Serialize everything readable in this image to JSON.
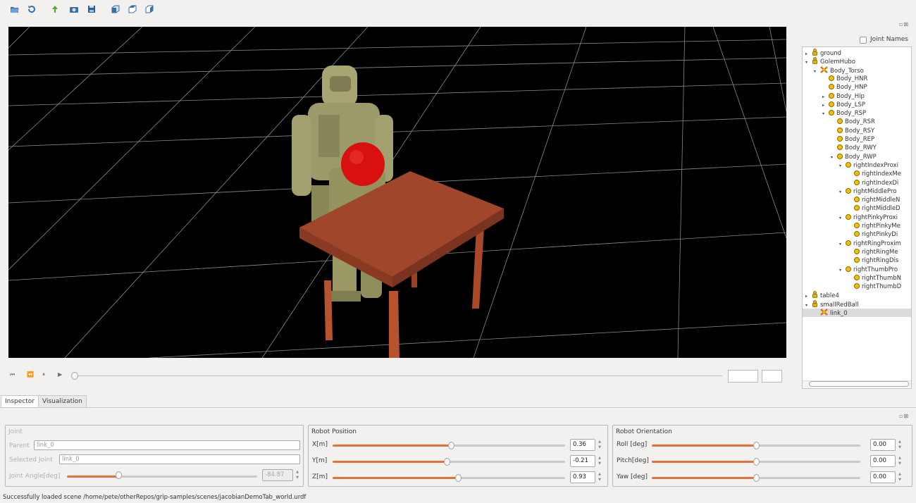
{
  "toolbar": {
    "icons": [
      "open-folder-icon",
      "reload-icon",
      "run-icon",
      "camera-icon",
      "save-icon",
      "front-view-icon",
      "top-view-icon",
      "side-view-icon"
    ]
  },
  "playback": {
    "icons": [
      "skip-start-icon",
      "rewind-icon",
      "pause-icon",
      "play-icon"
    ],
    "frame_value": "",
    "step_value": ""
  },
  "panel": {
    "joint_names_label": "Joint Names",
    "joint_names_checked": false,
    "dock_buttons": "▫⊠"
  },
  "tree": [
    {
      "label": "ground",
      "icon": "robot-icon",
      "arrow": "▸",
      "depth": 0
    },
    {
      "label": "GolemHubo",
      "icon": "robot-icon",
      "arrow": "▾",
      "depth": 0
    },
    {
      "label": "Body_Torso",
      "icon": "root-link-icon",
      "arrow": "▾",
      "depth": 1
    },
    {
      "label": "Body_HNR",
      "icon": "link-icon",
      "arrow": "",
      "depth": 2
    },
    {
      "label": "Body_HNP",
      "icon": "link-icon",
      "arrow": "",
      "depth": 2
    },
    {
      "label": "Body_Hip",
      "icon": "link-icon",
      "arrow": "▸",
      "depth": 2
    },
    {
      "label": "Body_LSP",
      "icon": "link-icon",
      "arrow": "▸",
      "depth": 2
    },
    {
      "label": "Body_RSP",
      "icon": "link-icon",
      "arrow": "▾",
      "depth": 2
    },
    {
      "label": "Body_RSR",
      "icon": "link-icon",
      "arrow": "",
      "depth": 3
    },
    {
      "label": "Body_RSY",
      "icon": "link-icon",
      "arrow": "",
      "depth": 3
    },
    {
      "label": "Body_REP",
      "icon": "link-icon",
      "arrow": "",
      "depth": 3
    },
    {
      "label": "Body_RWY",
      "icon": "link-icon",
      "arrow": "",
      "depth": 3
    },
    {
      "label": "Body_RWP",
      "icon": "link-icon",
      "arrow": "▾",
      "depth": 3
    },
    {
      "label": "rightIndexProxi",
      "icon": "link-icon",
      "arrow": "▾",
      "depth": 4
    },
    {
      "label": "rightIndexMe",
      "icon": "link-icon",
      "arrow": "",
      "depth": 5
    },
    {
      "label": "rightIndexDi",
      "icon": "link-icon",
      "arrow": "",
      "depth": 5
    },
    {
      "label": "rightMiddlePro",
      "icon": "link-icon",
      "arrow": "▾",
      "depth": 4
    },
    {
      "label": "rightMiddleN",
      "icon": "link-icon",
      "arrow": "",
      "depth": 5
    },
    {
      "label": "rightMiddleD",
      "icon": "link-icon",
      "arrow": "",
      "depth": 5
    },
    {
      "label": "rightPinkyProxi",
      "icon": "link-icon",
      "arrow": "▾",
      "depth": 4
    },
    {
      "label": "rightPinkyMe",
      "icon": "link-icon",
      "arrow": "",
      "depth": 5
    },
    {
      "label": "rightPinkyDi",
      "icon": "link-icon",
      "arrow": "",
      "depth": 5
    },
    {
      "label": "rightRingProxim",
      "icon": "link-icon",
      "arrow": "▾",
      "depth": 4
    },
    {
      "label": "rightRingMe",
      "icon": "link-icon",
      "arrow": "",
      "depth": 5
    },
    {
      "label": "rightRingDis",
      "icon": "link-icon",
      "arrow": "",
      "depth": 5
    },
    {
      "label": "rightThumbPro",
      "icon": "link-icon",
      "arrow": "▾",
      "depth": 4
    },
    {
      "label": "rightThumbN",
      "icon": "link-icon",
      "arrow": "",
      "depth": 5
    },
    {
      "label": "rightThumbD",
      "icon": "link-icon",
      "arrow": "",
      "depth": 5
    },
    {
      "label": "table4",
      "icon": "robot-icon",
      "arrow": "▸",
      "depth": 0
    },
    {
      "label": "smallRedBall",
      "icon": "robot-icon",
      "arrow": "▾",
      "depth": 0
    },
    {
      "label": "link_0",
      "icon": "root-link-icon",
      "arrow": "",
      "depth": 1,
      "selected": true
    }
  ],
  "tabs": [
    {
      "label": "Inspector",
      "active": true
    },
    {
      "label": "Visualization",
      "active": false
    }
  ],
  "inspector": {
    "joint": {
      "title": "Joint",
      "parent_label": "Parent",
      "parent_value": "link_0",
      "selected_label": "Selected Joint",
      "selected_value": "link_0",
      "angle_label": "Joint Angle[deg]",
      "angle_value": "-84.87",
      "angle_fraction": 0.27
    },
    "position": {
      "title": "Robot Position",
      "rows": [
        {
          "label": "X[m]",
          "value": "0.36",
          "fraction": 0.51
        },
        {
          "label": "Y[m]",
          "value": "-0.21",
          "fraction": 0.49
        },
        {
          "label": "Z[m]",
          "value": "0.93",
          "fraction": 0.54
        }
      ]
    },
    "orientation": {
      "title": "Robot Orientation",
      "rows": [
        {
          "label": "Roll [deg]",
          "value": "0.00",
          "fraction": 0.5
        },
        {
          "label": "Pitch[deg]",
          "value": "0.00",
          "fraction": 0.5
        },
        {
          "label": "Yaw  [deg]",
          "value": "0.00",
          "fraction": 0.5
        }
      ]
    }
  },
  "status_text": "Successfully loaded scene /home/pete/otherRepos/grip-samples/scenes/jacobianDemoTab_world.urdf",
  "colors": {
    "slider_fill": "#e2723c",
    "viewport_bg": "#000000",
    "table": "#a0462a",
    "ball": "#d81010",
    "robot": "#9b9a6a"
  }
}
